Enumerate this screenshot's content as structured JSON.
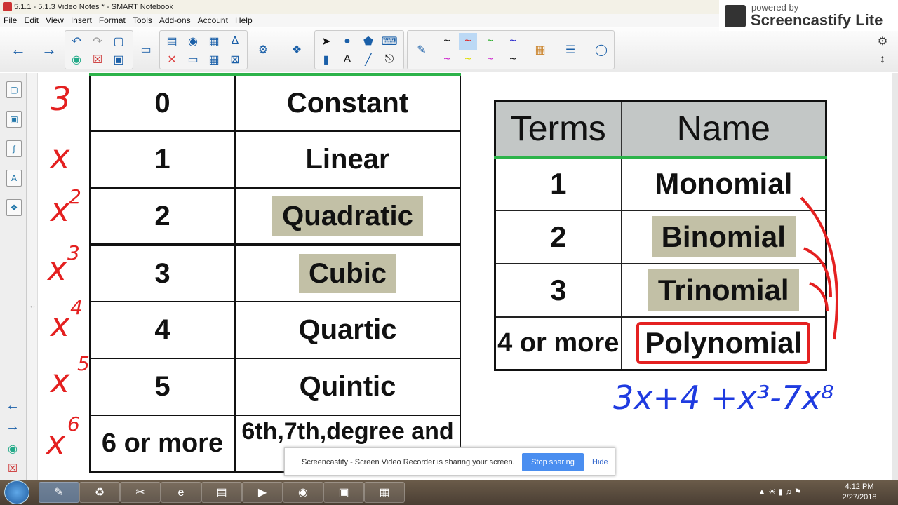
{
  "window": {
    "title": "5.1.1 - 5.1.3 Video Notes * - SMART Notebook"
  },
  "menu": [
    "File",
    "Edit",
    "View",
    "Insert",
    "Format",
    "Tools",
    "Add-ons",
    "Account",
    "Help"
  ],
  "screencastify": {
    "powered_by": "powered by",
    "brand": "Screencastify Lite"
  },
  "degree_table": {
    "rows": [
      {
        "degree": "0",
        "name": "Constant"
      },
      {
        "degree": "1",
        "name": "Linear"
      },
      {
        "degree": "2",
        "name": "Quadratic"
      },
      {
        "degree": "3",
        "name": "Cubic"
      },
      {
        "degree": "4",
        "name": "Quartic"
      },
      {
        "degree": "5",
        "name": "Quintic"
      },
      {
        "degree": "6 or more",
        "name": "6th,7th,degree and so on"
      }
    ]
  },
  "ink_powers": [
    "3",
    "x",
    "x",
    "2",
    "x",
    "3",
    "x",
    "4",
    "x",
    "5",
    "x",
    "6"
  ],
  "terms_table": {
    "header": {
      "terms": "Terms",
      "name": "Name"
    },
    "rows": [
      {
        "terms": "1",
        "name": "Monomial"
      },
      {
        "terms": "2",
        "name": "Binomial"
      },
      {
        "terms": "3",
        "name": "Trinomial"
      },
      {
        "terms": "4 or more",
        "name": "Polynomial"
      }
    ]
  },
  "example_expression": "3x+4 +x³-7x⁸",
  "notification": {
    "message": "Screencastify - Screen Video Recorder is sharing your screen.",
    "stop": "Stop sharing",
    "hide": "Hide"
  },
  "clock": {
    "time": "4:12 PM",
    "date": "2/27/2018"
  }
}
